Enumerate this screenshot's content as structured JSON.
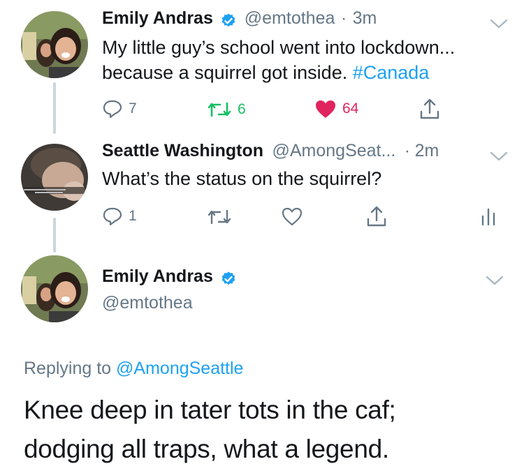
{
  "tweet1": {
    "name": "Emily Andras",
    "handle": "@emtothea",
    "separator": "·",
    "time": "3m",
    "text_main": "My little guy’s school went into lockdown... because a squirrel got inside. ",
    "hashtag": "#Canada",
    "replies": "7",
    "retweets": "6",
    "likes": "64",
    "retweet_color": "#17bf63",
    "like_color": "#e0245e"
  },
  "tweet2": {
    "name": "Seattle Washington",
    "handle": "@AmongSeat...",
    "separator": "·",
    "time": "2m",
    "text": "What’s the status on the squirrel?",
    "replies": "1"
  },
  "tweet3": {
    "name": "Emily Andras",
    "handle": "@emtothea",
    "replying_prefix": "Replying to ",
    "replying_to": "@AmongSeattle",
    "text": "Knee deep in tater tots in the caf; dodging all traps, what a legend."
  },
  "colors": {
    "accent": "#1da1f2",
    "muted": "#657786",
    "line": "#ccd6dd"
  }
}
